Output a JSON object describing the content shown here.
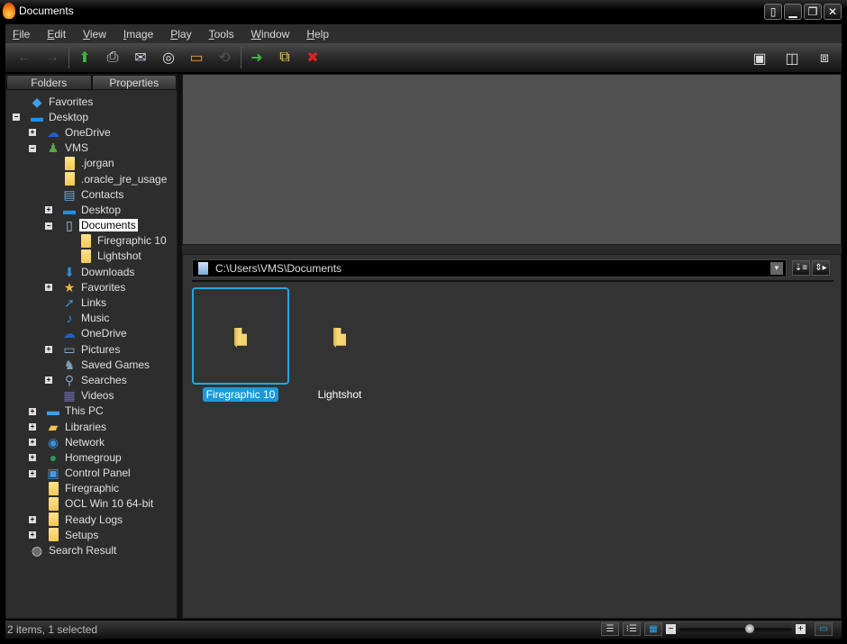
{
  "window": {
    "title": "Documents",
    "buttons": [
      "compact",
      "minimize",
      "restore",
      "close"
    ]
  },
  "menu": [
    "File",
    "Edit",
    "View",
    "Image",
    "Play",
    "Tools",
    "Window",
    "Help"
  ],
  "menu_mnemonics": [
    "F",
    "E",
    "V",
    "I",
    "P",
    "T",
    "W",
    "H"
  ],
  "toolbar": {
    "left": [
      {
        "name": "back-icon",
        "glyph": "←",
        "disabled": true
      },
      {
        "name": "forward-icon",
        "glyph": "→",
        "disabled": true
      },
      {
        "name": "up-folder-icon",
        "glyph": "⬆",
        "disabled": false
      },
      {
        "name": "print-icon",
        "glyph": "⎙",
        "disabled": false
      },
      {
        "name": "email-icon",
        "glyph": "✉",
        "disabled": false
      },
      {
        "name": "burn-disc-icon",
        "glyph": "◎",
        "disabled": false
      },
      {
        "name": "slideshow-icon",
        "glyph": "▭",
        "disabled": false
      },
      {
        "name": "convert-icon",
        "glyph": "⟲",
        "disabled": true
      },
      {
        "name": "move-to-folder-icon",
        "glyph": "➜",
        "disabled": false
      },
      {
        "name": "copy-to-folder-icon",
        "glyph": "⧉",
        "disabled": false
      },
      {
        "name": "delete-icon",
        "glyph": "✖",
        "disabled": false
      }
    ],
    "right": [
      {
        "name": "preview-toggle-icon",
        "glyph": "▣"
      },
      {
        "name": "panel-layout-icon",
        "glyph": "◫"
      },
      {
        "name": "fullscreen-icon",
        "glyph": "⧈"
      }
    ]
  },
  "left_pane": {
    "tabs": [
      "Folders",
      "Properties"
    ],
    "active_tab": "Folders",
    "tree": [
      {
        "label": "Favorites",
        "level": 0,
        "expander": "",
        "icon": "tag",
        "color": "#3ea1e8"
      },
      {
        "label": "Desktop",
        "level": 0,
        "expander": "-",
        "icon": "desktop",
        "color": "#1e8ee8"
      },
      {
        "label": "OneDrive",
        "level": 1,
        "expander": "+",
        "icon": "cloud",
        "color": "#1f5fc8"
      },
      {
        "label": "VMS",
        "level": 1,
        "expander": "-",
        "icon": "user",
        "color": "#5aa548"
      },
      {
        "label": ".jorgan",
        "level": 2,
        "expander": "",
        "icon": "folder",
        "color": "#f4d06d"
      },
      {
        "label": ".oracle_jre_usage",
        "level": 2,
        "expander": "",
        "icon": "folder",
        "color": "#f4d06d"
      },
      {
        "label": "Contacts",
        "level": 2,
        "expander": "",
        "icon": "contacts",
        "color": "#6fa6d8"
      },
      {
        "label": "Desktop",
        "level": 2,
        "expander": "+",
        "icon": "desktop",
        "color": "#1e8ee8"
      },
      {
        "label": "Documents",
        "level": 2,
        "expander": "-",
        "icon": "document",
        "color": "#9ec5ea",
        "selected": true
      },
      {
        "label": "Firegraphic 10",
        "level": 3,
        "expander": "",
        "icon": "folder",
        "color": "#f4d06d"
      },
      {
        "label": "Lightshot",
        "level": 3,
        "expander": "",
        "icon": "folder",
        "color": "#f4d06d"
      },
      {
        "label": "Downloads",
        "level": 2,
        "expander": "",
        "icon": "download",
        "color": "#2e8fe0"
      },
      {
        "label": "Favorites",
        "level": 2,
        "expander": "+",
        "icon": "star",
        "color": "#f5b73b"
      },
      {
        "label": "Links",
        "level": 2,
        "expander": "",
        "icon": "link",
        "color": "#2e8fe0"
      },
      {
        "label": "Music",
        "level": 2,
        "expander": "",
        "icon": "music",
        "color": "#2e8fe0"
      },
      {
        "label": "OneDrive",
        "level": 2,
        "expander": "",
        "icon": "cloud",
        "color": "#1f5fc8"
      },
      {
        "label": "Pictures",
        "level": 2,
        "expander": "+",
        "icon": "pictures",
        "color": "#8fb8d8"
      },
      {
        "label": "Saved Games",
        "level": 2,
        "expander": "",
        "icon": "games",
        "color": "#7fa0c0"
      },
      {
        "label": "Searches",
        "level": 2,
        "expander": "+",
        "icon": "search",
        "color": "#8aa0b8"
      },
      {
        "label": "Videos",
        "level": 2,
        "expander": "",
        "icon": "video",
        "color": "#6a6aa8"
      },
      {
        "label": "This PC",
        "level": 1,
        "expander": "+",
        "icon": "computer",
        "color": "#3aa0e8"
      },
      {
        "label": "Libraries",
        "level": 1,
        "expander": "+",
        "icon": "libraries",
        "color": "#f4c24d"
      },
      {
        "label": "Network",
        "level": 1,
        "expander": "+",
        "icon": "network",
        "color": "#3a8fd8"
      },
      {
        "label": "Homegroup",
        "level": 1,
        "expander": "+",
        "icon": "homegroup",
        "color": "#2a9a5a"
      },
      {
        "label": "Control Panel",
        "level": 1,
        "expander": "+",
        "icon": "control-panel",
        "color": "#4a9ae0"
      },
      {
        "label": "Firegraphic",
        "level": 1,
        "expander": "",
        "icon": "folder",
        "color": "#f4d06d"
      },
      {
        "label": "OCL Win 10 64-bit",
        "level": 1,
        "expander": "",
        "icon": "folder",
        "color": "#f4d06d"
      },
      {
        "label": "Ready Logs",
        "level": 1,
        "expander": "+",
        "icon": "folder",
        "color": "#f4d06d"
      },
      {
        "label": "Setups",
        "level": 1,
        "expander": "+",
        "icon": "folder",
        "color": "#f4d06d"
      },
      {
        "label": "Search Result",
        "level": 0,
        "expander": "",
        "icon": "search-result",
        "color": "#cccccc"
      }
    ]
  },
  "browser": {
    "path": "C:\\Users\\VMS\\Documents",
    "items": [
      {
        "label": "Firegraphic 10",
        "selected": true
      },
      {
        "label": "Lightshot",
        "selected": false
      }
    ]
  },
  "status": {
    "text": "2 items, 1 selected",
    "view_modes": [
      "details",
      "list",
      "thumbnails"
    ],
    "active_view": "thumbnails",
    "zoom_fraction": 0.62
  },
  "colors": {
    "accent": "#1fa8e0",
    "selection_label": "#1a9bd7"
  }
}
